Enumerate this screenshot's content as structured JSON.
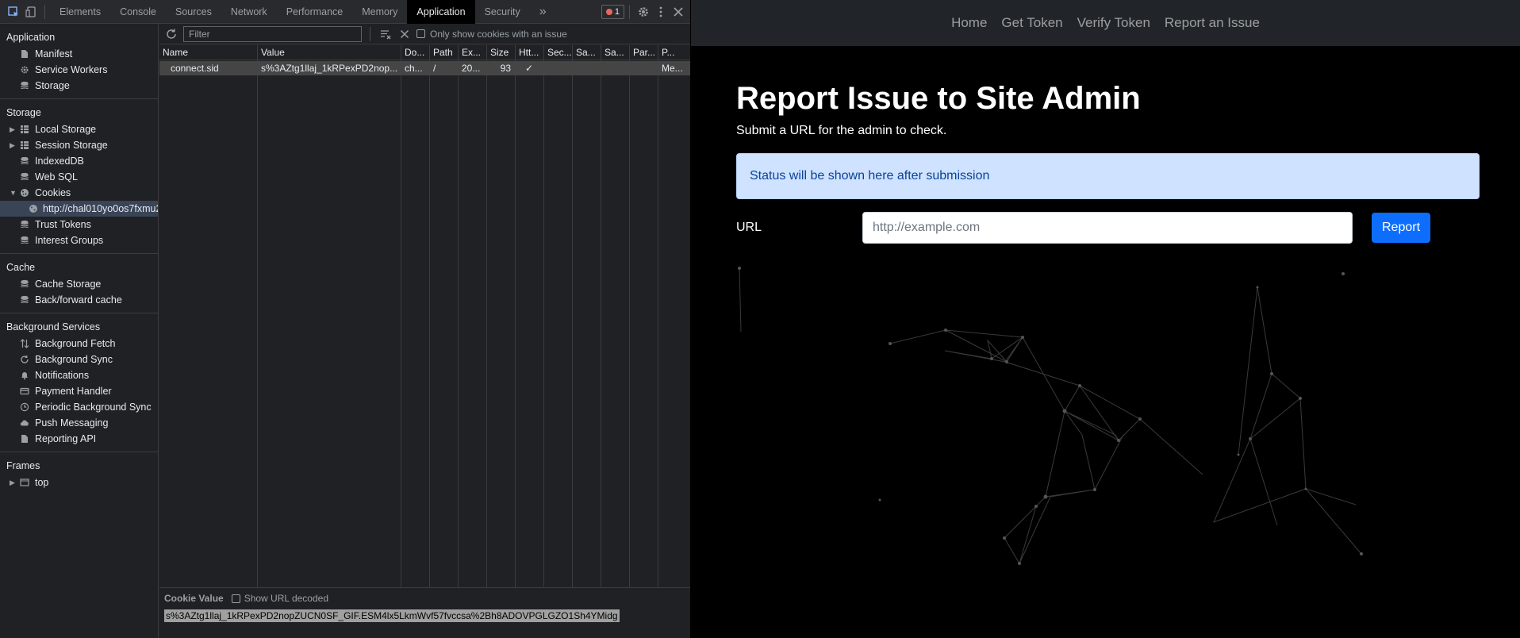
{
  "devtools": {
    "tabs": [
      "Elements",
      "Console",
      "Sources",
      "Network",
      "Performance",
      "Memory",
      "Application",
      "Security"
    ],
    "active_tab": "Application",
    "more_tabs_glyph": "»",
    "error_count": "1",
    "sidebar": {
      "application": {
        "title": "Application",
        "items": [
          "Manifest",
          "Service Workers",
          "Storage"
        ]
      },
      "storage": {
        "title": "Storage",
        "items": [
          "Local Storage",
          "Session Storage",
          "IndexedDB",
          "Web SQL",
          "Cookies",
          "http://chal010yo0os7fxmu2",
          "Trust Tokens",
          "Interest Groups"
        ]
      },
      "cache": {
        "title": "Cache",
        "items": [
          "Cache Storage",
          "Back/forward cache"
        ]
      },
      "background_services": {
        "title": "Background Services",
        "items": [
          "Background Fetch",
          "Background Sync",
          "Notifications",
          "Payment Handler",
          "Periodic Background Sync",
          "Push Messaging",
          "Reporting API"
        ]
      },
      "frames": {
        "title": "Frames",
        "items": [
          "top"
        ]
      }
    },
    "cookies": {
      "filter_placeholder": "Filter",
      "only_issues_label": "Only show cookies with an issue",
      "columns": [
        "Name",
        "Value",
        "Do...",
        "Path",
        "Ex...",
        "Size",
        "Htt...",
        "Sec...",
        "Sa...",
        "Sa...",
        "Par...",
        "P..."
      ],
      "rows": [
        {
          "name": "connect.sid",
          "value": "s%3AZtg1llaj_1kRPexPD2nop...",
          "domain": "ch...",
          "path": "/",
          "expires": "20...",
          "size": "93",
          "httponly": "✓",
          "secure": "",
          "samesite": "",
          "sameparty": "",
          "partition": "",
          "priority": "Me..."
        }
      ],
      "value_pane": {
        "title": "Cookie Value",
        "decode_label": "Show URL decoded",
        "value": "s%3AZtg1llaj_1kRPexPD2nopZUCN0SF_GIF.ESM4lx5LkmWvf57fvccsa%2Bh8ADOVPGLGZO1Sh4YMidg"
      }
    }
  },
  "page": {
    "nav": [
      "Home",
      "Get Token",
      "Verify Token",
      "Report an Issue"
    ],
    "title": "Report Issue to Site Admin",
    "subtitle": "Submit a URL for the admin to check.",
    "status": "Status will be shown here after submission",
    "url_label": "URL",
    "url_placeholder": "http://example.com",
    "report_button": "Report",
    "colors": {
      "primary": "#0d6efd",
      "alert_bg": "#cfe2ff",
      "alert_text": "#084298",
      "navbar": "#212529"
    }
  }
}
